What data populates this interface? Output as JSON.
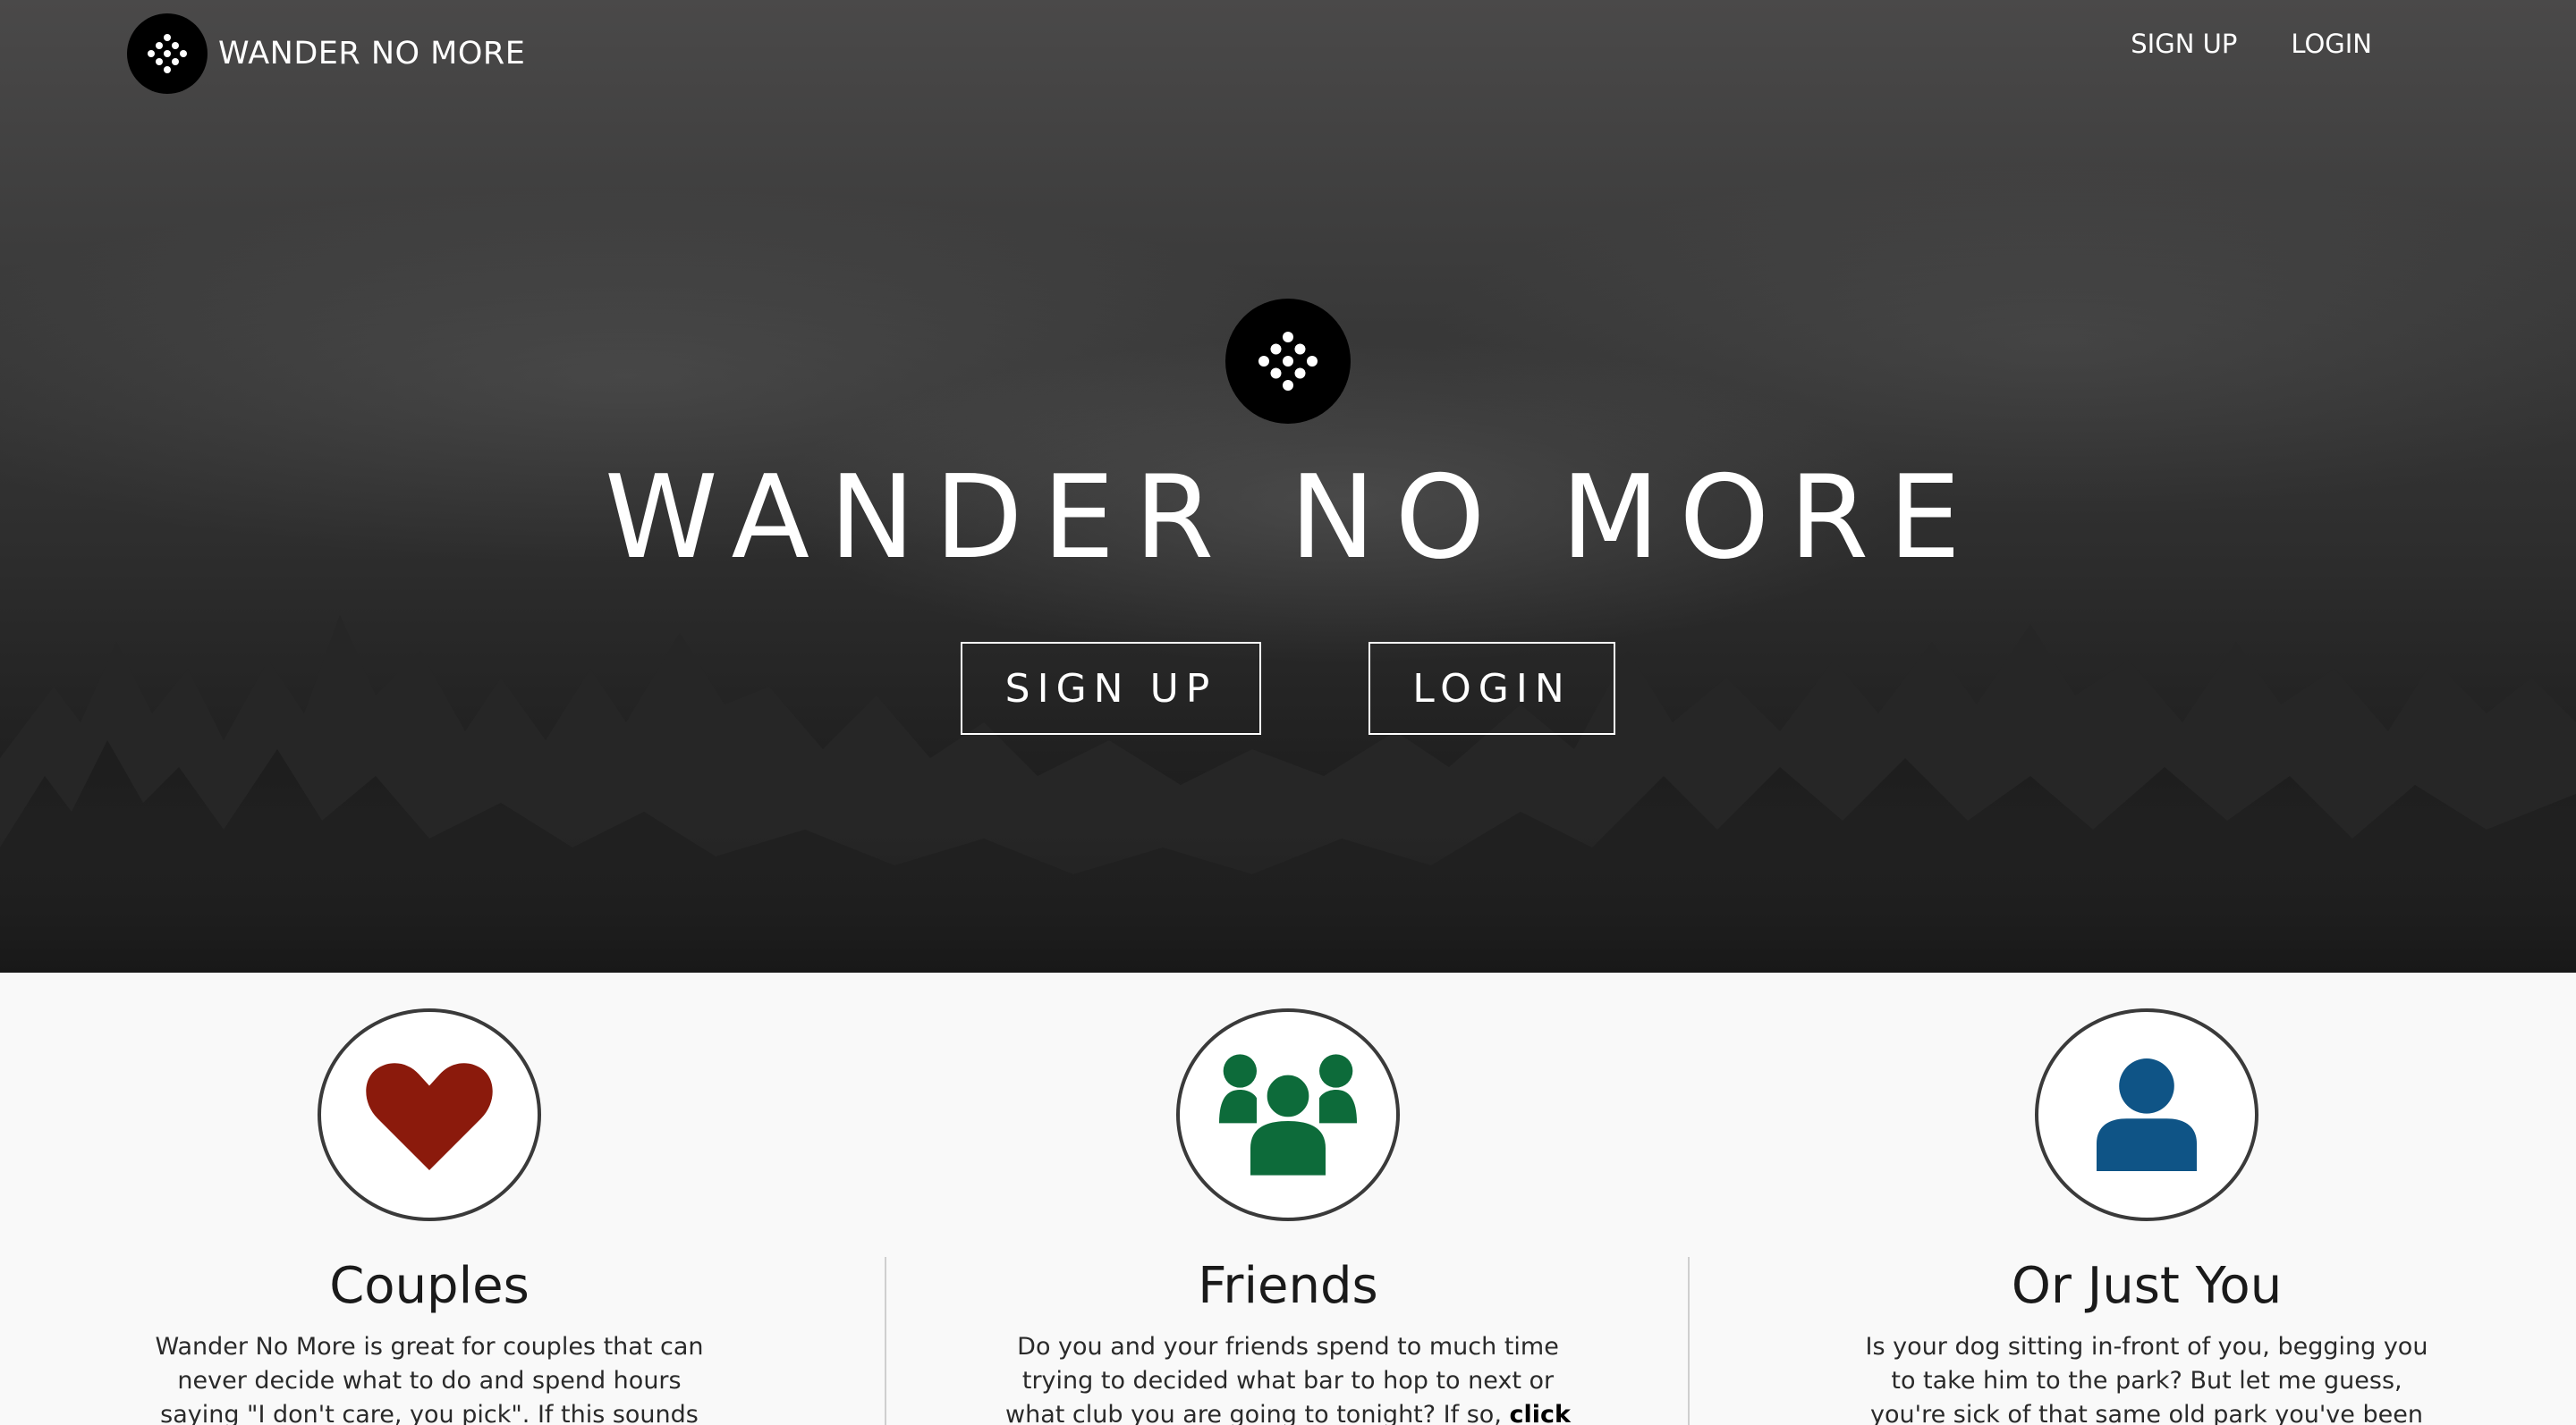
{
  "nav": {
    "brand": "WANDER NO MORE",
    "links": [
      "SIGN UP",
      "LOGIN"
    ]
  },
  "hero": {
    "title": "WANDER NO MORE",
    "signup_label": "SIGN UP",
    "login_label": "LOGIN"
  },
  "features": [
    {
      "title": "Couples",
      "icon": "heart-icon",
      "color": "#8b1a0c",
      "text_lines": [
        "Wander No More is great for couples that can",
        "never decide what to do and spend hours",
        "saying \"I don't care, you pick\". If this sounds"
      ]
    },
    {
      "title": "Friends",
      "icon": "users-icon",
      "color": "#0d6b3a",
      "text_lines": [
        "Do you and your friends spend to much time",
        "trying to decided what bar to hop to next or",
        "what club you are going to tonight? If so,"
      ],
      "link_text": "click"
    },
    {
      "title": "Or Just You",
      "icon": "user-icon",
      "color": "#0f5486",
      "text_lines": [
        "Is your dog sitting in-front of you, begging you",
        "to take him to the park? But let me guess,",
        "you're sick of that same old park you've been"
      ]
    }
  ]
}
